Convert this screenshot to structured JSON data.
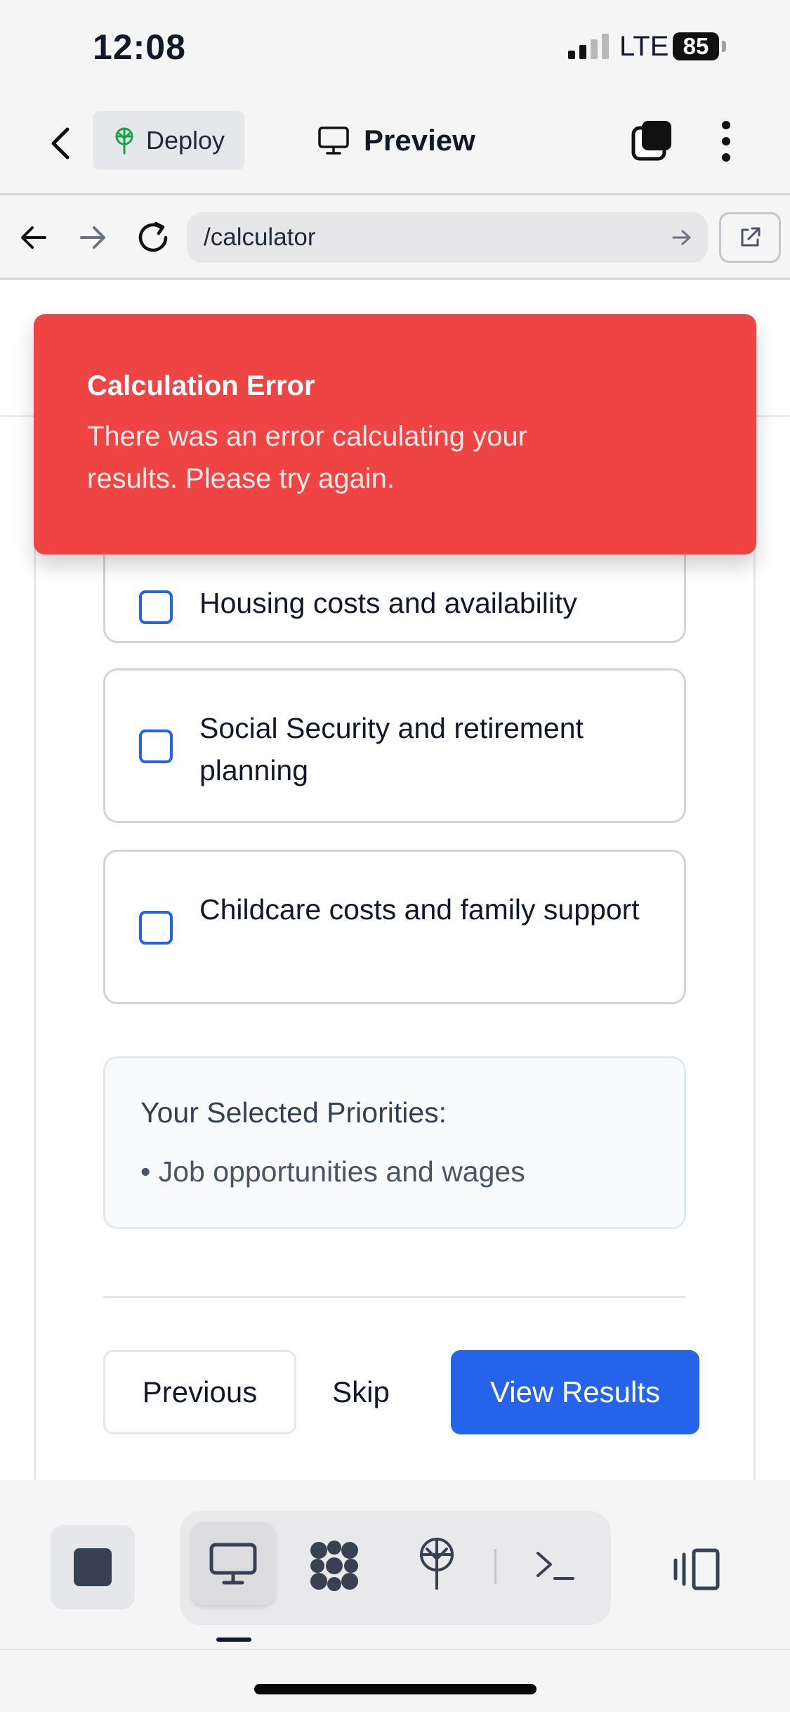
{
  "status_bar": {
    "time": "12:08",
    "network": "LTE",
    "battery": "85"
  },
  "app_toolbar": {
    "deploy_label": "Deploy",
    "preview_label": "Preview"
  },
  "url_bar": {
    "url": "/calculator"
  },
  "toast": {
    "title": "Calculation Error",
    "message": "There was an error calculating your results. Please try again.",
    "color": "#ef4444"
  },
  "options": [
    {
      "label": "Housing costs and availability",
      "checked": false
    },
    {
      "label": "Social Security and retirement planning",
      "checked": false
    },
    {
      "label": "Childcare costs and family support",
      "checked": false
    }
  ],
  "selected_priorities": {
    "title": "Your Selected Priorities:",
    "items": [
      "• Job opportunities and wages"
    ]
  },
  "navigation": {
    "previous_label": "Previous",
    "skip_label": "Skip",
    "view_results_label": "View Results",
    "accent_color": "#2563eb"
  },
  "bottom_toolbar": {
    "tools": [
      "stop-icon",
      "desktop-icon",
      "ai-agent-icon",
      "deploy-icon",
      "shell-icon",
      "panel-toggle-icon"
    ]
  }
}
